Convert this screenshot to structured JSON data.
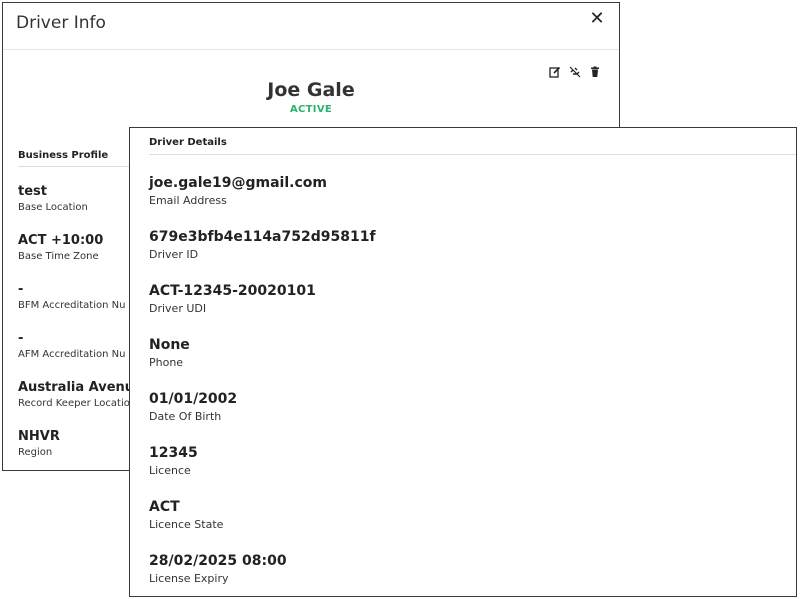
{
  "driver_info": {
    "title": "Driver Info",
    "close_label": "✕",
    "name": "Joe Gale",
    "status": "ACTIVE",
    "status_color": "#2ab36d",
    "icons": [
      "edit-icon",
      "unlink-icon",
      "trash-icon"
    ],
    "business_profile": {
      "title": "Business Profile",
      "fields": [
        {
          "value": "test",
          "label": "Base Location"
        },
        {
          "value": "ACT +10:00",
          "label": "Base Time Zone"
        },
        {
          "value": "-",
          "label": "BFM Accreditation Nu"
        },
        {
          "value": "-",
          "label": "AFM Accreditation Nu"
        },
        {
          "value": "Australia Avenue",
          "label": "Record Keeper Locatio"
        },
        {
          "value": "NHVR",
          "label": "Region"
        }
      ]
    }
  },
  "driver_details": {
    "title": "Driver Details",
    "fields": [
      {
        "value": "joe.gale19@gmail.com",
        "label": "Email Address"
      },
      {
        "value": "679e3bfb4e114a752d95811f",
        "label": "Driver ID"
      },
      {
        "value": "ACT-12345-20020101",
        "label": "Driver UDI"
      },
      {
        "value": "None",
        "label": "Phone"
      },
      {
        "value": "01/01/2002",
        "label": "Date Of Birth"
      },
      {
        "value": "12345",
        "label": "Licence"
      },
      {
        "value": "ACT",
        "label": "Licence State"
      },
      {
        "value": "28/02/2025 08:00",
        "label": "License Expiry"
      }
    ]
  }
}
